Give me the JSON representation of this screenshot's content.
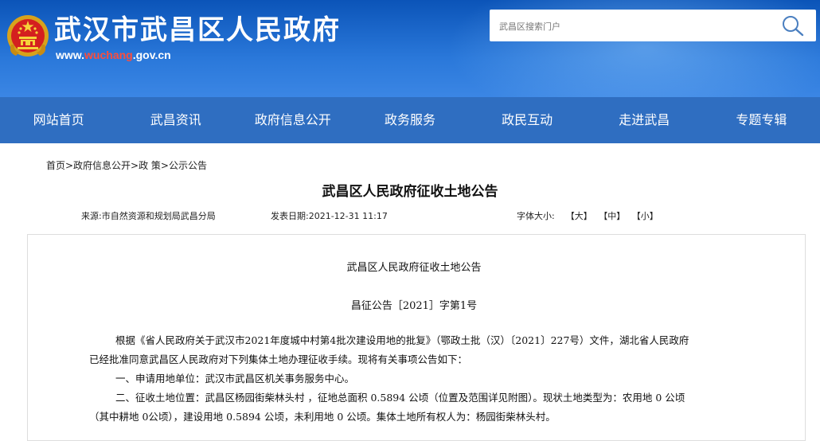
{
  "header": {
    "title": "武汉市武昌区人民政府",
    "url_prefix": "www.",
    "url_accent": "wuchang",
    "url_suffix": ".gov.cn",
    "colors": {
      "header_blue": "#0b54b8",
      "nav_blue": "#2f6ec1",
      "url_accent": "#ff4d3a"
    },
    "emblem_icon": "national-emblem-icon"
  },
  "search": {
    "placeholder": "武昌区搜索门户",
    "icon": "search-icon"
  },
  "nav": {
    "items": [
      {
        "label": "网站首页"
      },
      {
        "label": "武昌资讯"
      },
      {
        "label": "政府信息公开"
      },
      {
        "label": "政务服务"
      },
      {
        "label": "政民互动"
      },
      {
        "label": "走进武昌"
      },
      {
        "label": "专题专辑"
      }
    ]
  },
  "breadcrumb": "首页>政府信息公开>政 策>公示公告",
  "article": {
    "title": "武昌区人民政府征收土地公告",
    "source": "来源:市自然资源和规划局武昌分局",
    "date": "发表日期:2021-12-31 11:17",
    "font_size_label": "字体大小:",
    "font_sizes": [
      "【大】",
      "【中】",
      "【小】"
    ],
    "doc_title": "武昌区人民政府征收土地公告",
    "doc_number": "昌征公告［2021］字第1号",
    "lines": [
      "根据《省人民政府关于武汉市2021年度城中村第4批次建设用地的批复》（鄂政土批（汉）〔2021〕227号）文件，湖北省人民政府",
      "已经批准同意武昌区人民政府对下列集体土地办理征收手续。现将有关事项公告如下：",
      "一、申请用地单位：武汉市武昌区机关事务服务中心。",
      "二、征收土地位置：武昌区杨园街柴林头村 ，征地总面积 0.5894  公顷（位置及范围详见附图）。现状土地类型为：农用地 0  公顷",
      "（其中耕地 0公顷），建设用地 0.5894  公顷，未利用地 0  公顷。集体土地所有权人为：杨园街柴林头村。"
    ]
  }
}
